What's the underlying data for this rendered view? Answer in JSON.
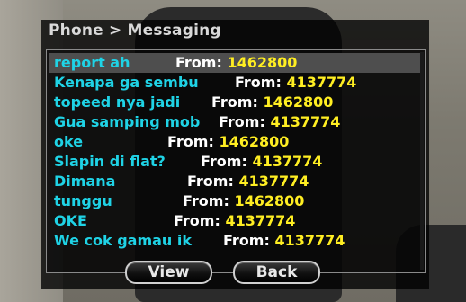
{
  "dialog": {
    "title": "Phone > Messaging",
    "from_label": "From:",
    "view_label": "View",
    "back_label": "Back"
  },
  "messages": [
    {
      "text": "report ah",
      "from": "1462800",
      "selected": true
    },
    {
      "text": "Kenapa ga sembu",
      "from": "4137774",
      "selected": false
    },
    {
      "text": "topeed nya jadi",
      "from": "1462800",
      "selected": false
    },
    {
      "text": "Gua samping mob",
      "from": "4137774",
      "selected": false
    },
    {
      "text": "oke",
      "from": "1462800",
      "selected": false
    },
    {
      "text": "Slapin di flat?",
      "from": "4137774",
      "selected": false
    },
    {
      "text": "Dimana",
      "from": "4137774",
      "selected": false
    },
    {
      "text": "tunggu",
      "from": "1462800",
      "selected": false
    },
    {
      "text": "OKE",
      "from": "4137774",
      "selected": false
    },
    {
      "text": "We cok gamau ik",
      "from": "4137774",
      "selected": false
    }
  ],
  "colors": {
    "message_text": "#1fd3e6",
    "from_label": "#ffffff",
    "from_number": "#ffee22",
    "selected_row": "#4e4e4e"
  }
}
